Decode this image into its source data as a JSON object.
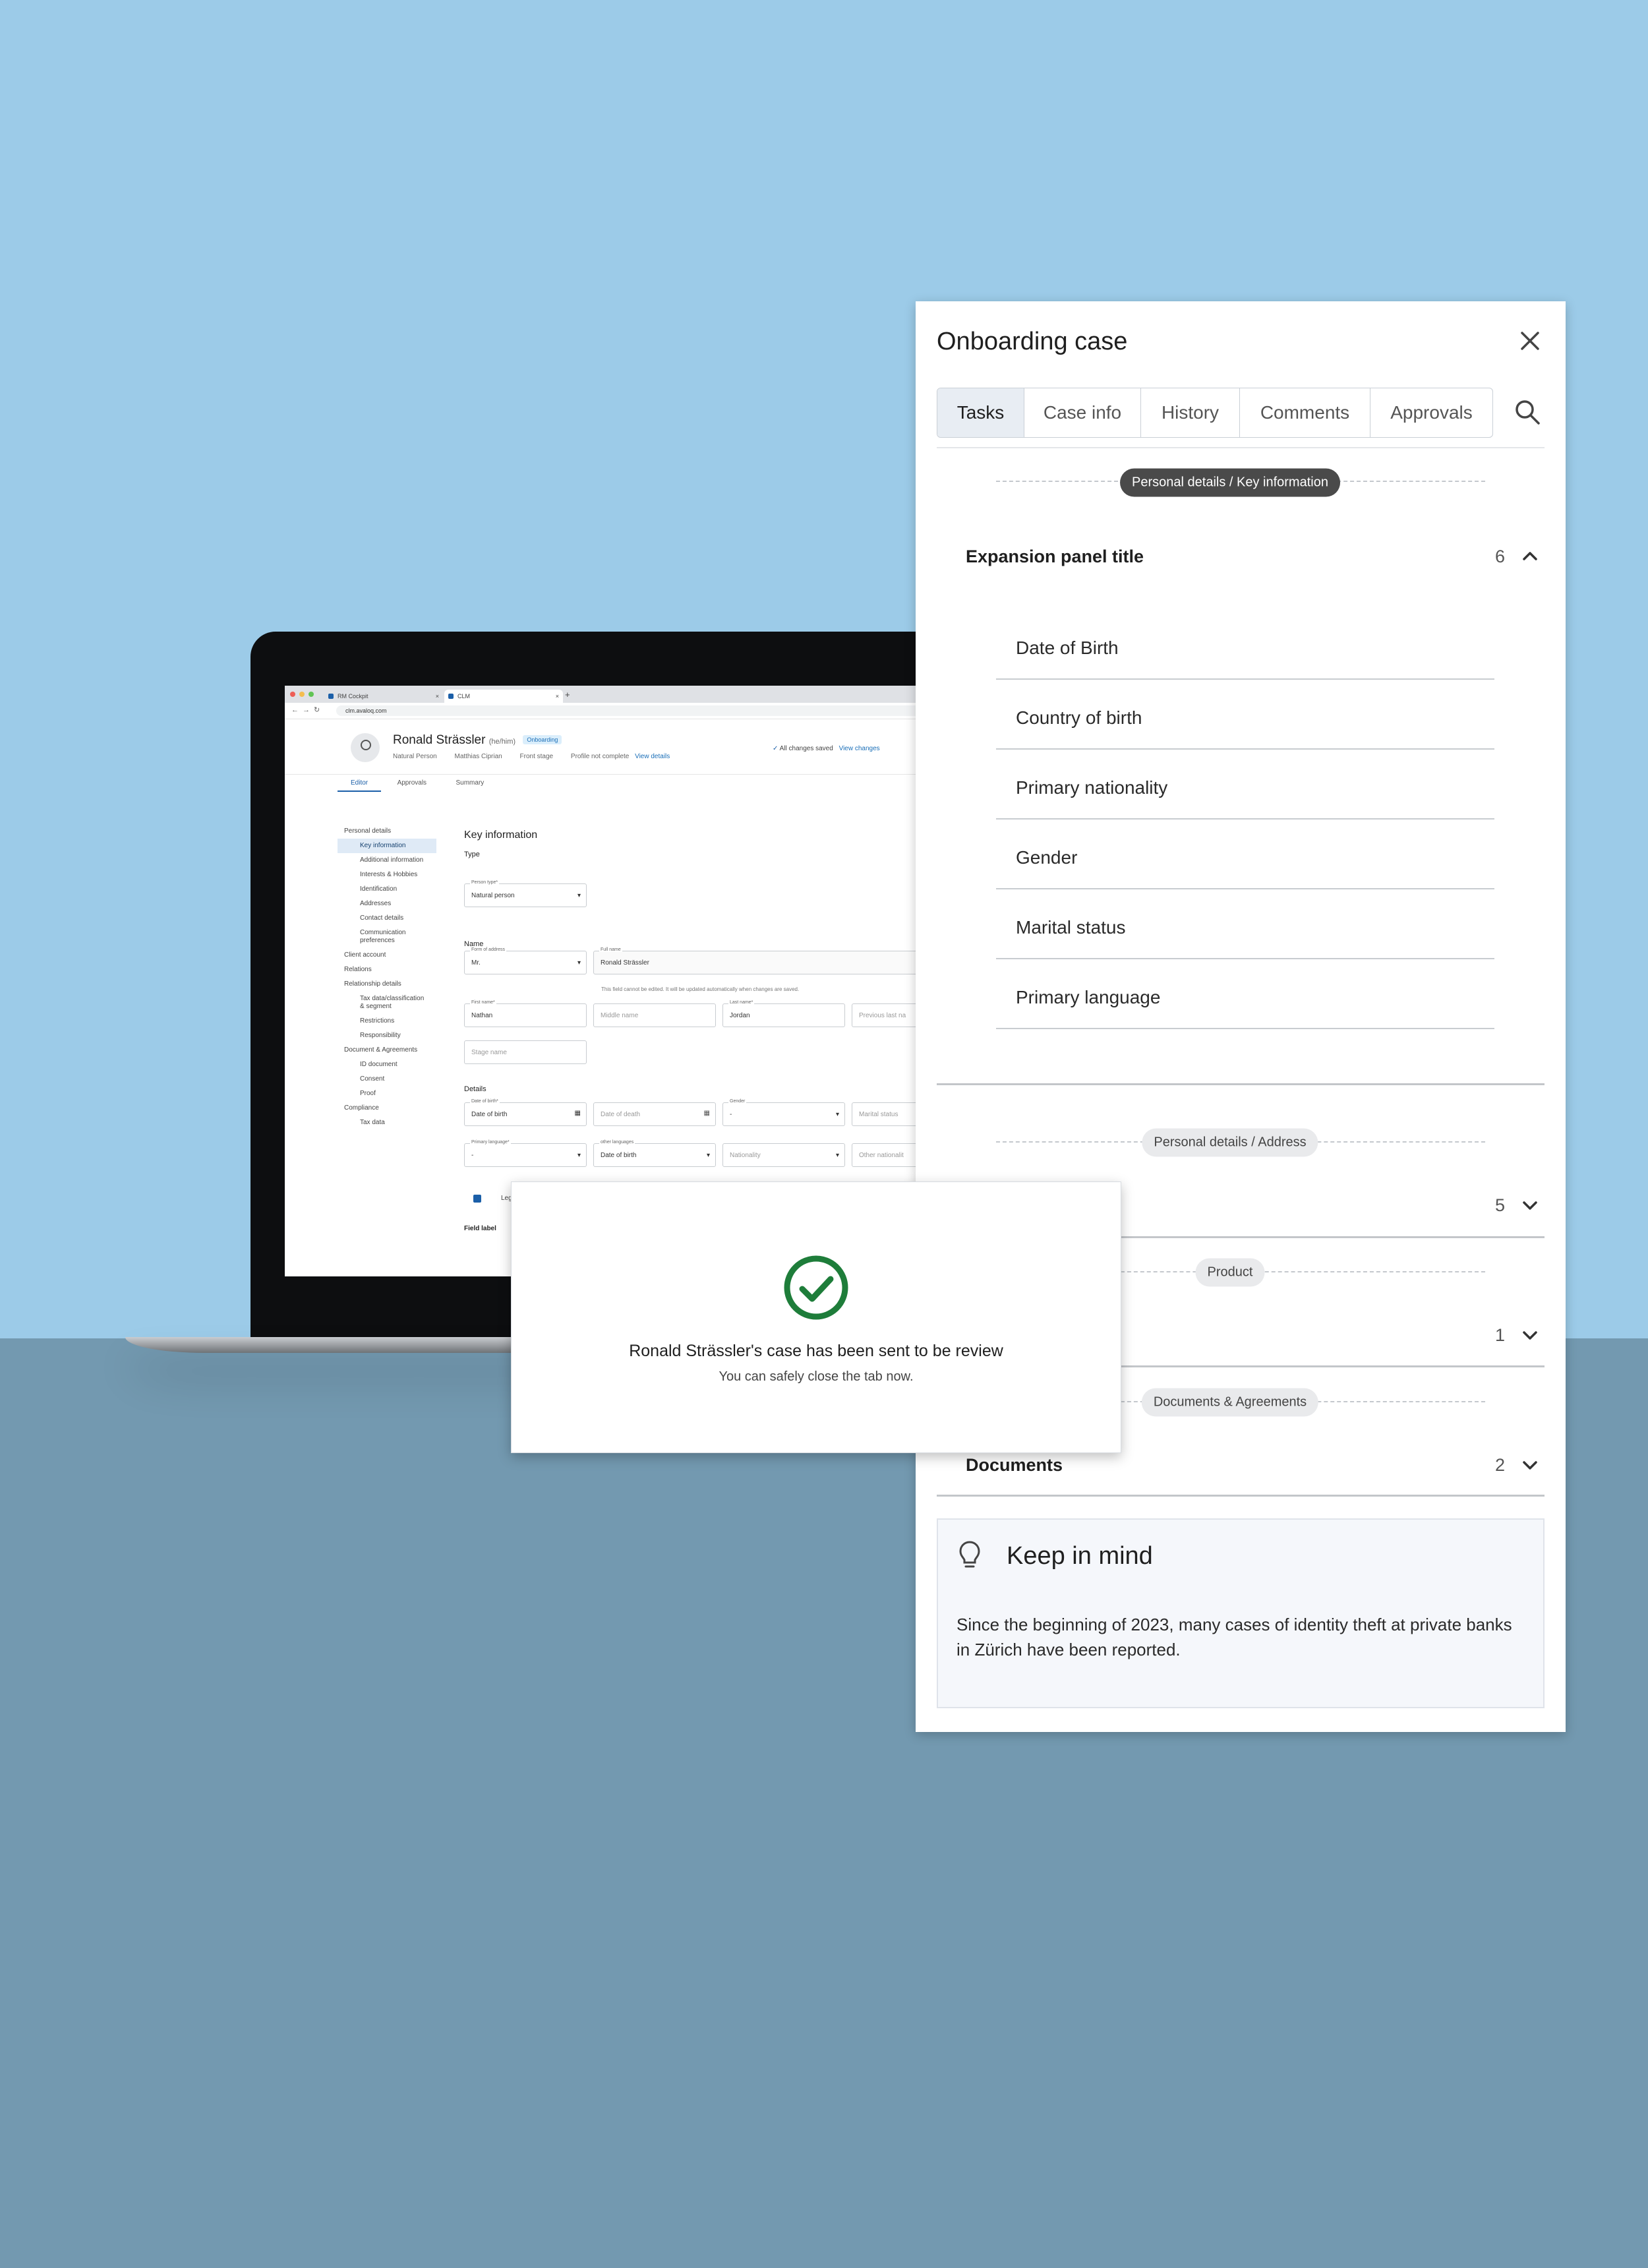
{
  "browser": {
    "tabs": [
      {
        "label": "RM Cockpit"
      },
      {
        "label": "CLM"
      }
    ],
    "url": "clm.avaloq.com"
  },
  "client_header": {
    "name": "Ronald Strässler",
    "pronoun": "(he/him)",
    "badge": "Onboarding",
    "meta": [
      "Natural Person",
      "Matthias Ciprian",
      "Front stage",
      "Profile not complete"
    ],
    "view_details": "View details",
    "saved_status": "All changes saved",
    "view_changes": "View changes"
  },
  "app_tabs": [
    "Editor",
    "Approvals",
    "Summary"
  ],
  "sidenav": {
    "items": [
      {
        "label": "Personal details",
        "level": 0
      },
      {
        "label": "Key information",
        "level": 1,
        "selected": true
      },
      {
        "label": "Additional information",
        "level": 1
      },
      {
        "label": "Interests & Hobbies",
        "level": 1
      },
      {
        "label": "Identification",
        "level": 1
      },
      {
        "label": "Addresses",
        "level": 1
      },
      {
        "label": "Contact details",
        "level": 1
      },
      {
        "label": "Communication preferences",
        "level": 1
      },
      {
        "label": "Client account",
        "level": 0
      },
      {
        "label": "Relations",
        "level": 0
      },
      {
        "label": "Relationship details",
        "level": 0
      },
      {
        "label": "Tax data/classification & segment",
        "level": 1
      },
      {
        "label": "Restrictions",
        "level": 1
      },
      {
        "label": "Responsibility",
        "level": 1
      },
      {
        "label": "Document & Agreements",
        "level": 0
      },
      {
        "label": "ID document",
        "level": 1
      },
      {
        "label": "Consent",
        "level": 1
      },
      {
        "label": "Proof",
        "level": 1
      },
      {
        "label": "Compliance",
        "level": 0
      },
      {
        "label": "Tax data",
        "level": 1
      }
    ]
  },
  "form": {
    "title": "Key information",
    "type_section": "Type",
    "person_type": {
      "label": "Person type*",
      "value": "Natural person"
    },
    "name_section": "Name",
    "form_of_address": {
      "label": "Form of address",
      "value": "Mr."
    },
    "full_name": {
      "label": "Full name",
      "value": "Ronald Strässler"
    },
    "full_name_hint": "This field cannot be edited. It will be updated automatically when changes are saved.",
    "first_name": {
      "label": "First name*",
      "value": "Nathan"
    },
    "middle_name": {
      "placeholder": "Middle name"
    },
    "last_name": {
      "label": "Last name*",
      "value": "Jordan"
    },
    "previous_last_name": {
      "placeholder": "Previous last na"
    },
    "stage_name": {
      "placeholder": "Stage name"
    },
    "details_section": "Details",
    "date_of_birth": {
      "label": "Date of birth*",
      "value": "Date of birth"
    },
    "date_of_death": {
      "placeholder": "Date of death"
    },
    "gender": {
      "label": "Gender",
      "value": "-"
    },
    "marital_status": {
      "placeholder": "Marital status"
    },
    "primary_language": {
      "label": "Primary language*",
      "value": "-"
    },
    "other_languages": {
      "label": "other languages",
      "value": "Date of birth"
    },
    "nationality": {
      "placeholder": "Nationality"
    },
    "other_nationality": {
      "placeholder": "Other nationalit"
    },
    "checkbox_label": "Leg",
    "field_label": "Field label"
  },
  "dialog": {
    "title": "Ronald Strässler's case has been sent to be review",
    "subtitle": "You can safely close the tab now.",
    "icon": "check-circle-icon",
    "icon_color": "#1e7d3a"
  },
  "panel": {
    "title": "Onboarding case",
    "tabs": [
      {
        "label": "Tasks",
        "active": true
      },
      {
        "label": "Case info"
      },
      {
        "label": "History"
      },
      {
        "label": "Comments"
      },
      {
        "label": "Approvals"
      }
    ],
    "sections": [
      {
        "chip": "Personal details / Key information",
        "title": "Expansion panel title",
        "count": "6",
        "expanded": true,
        "items": [
          "Date of Birth",
          "Country of birth",
          "Primary nationality",
          "Gender",
          "Marital status",
          "Primary language"
        ]
      },
      {
        "chip": "Personal details / Address",
        "count": "5",
        "expanded": false
      },
      {
        "chip": "Product",
        "count": "1",
        "expanded": false
      },
      {
        "chip": "Documents & Agreements",
        "title": "Documents",
        "count": "2",
        "expanded": false
      }
    ],
    "keep_in_mind": {
      "title": "Keep in mind",
      "body": "Since the beginning of 2023, many cases of identity theft at private banks in Zürich have been reported."
    }
  }
}
